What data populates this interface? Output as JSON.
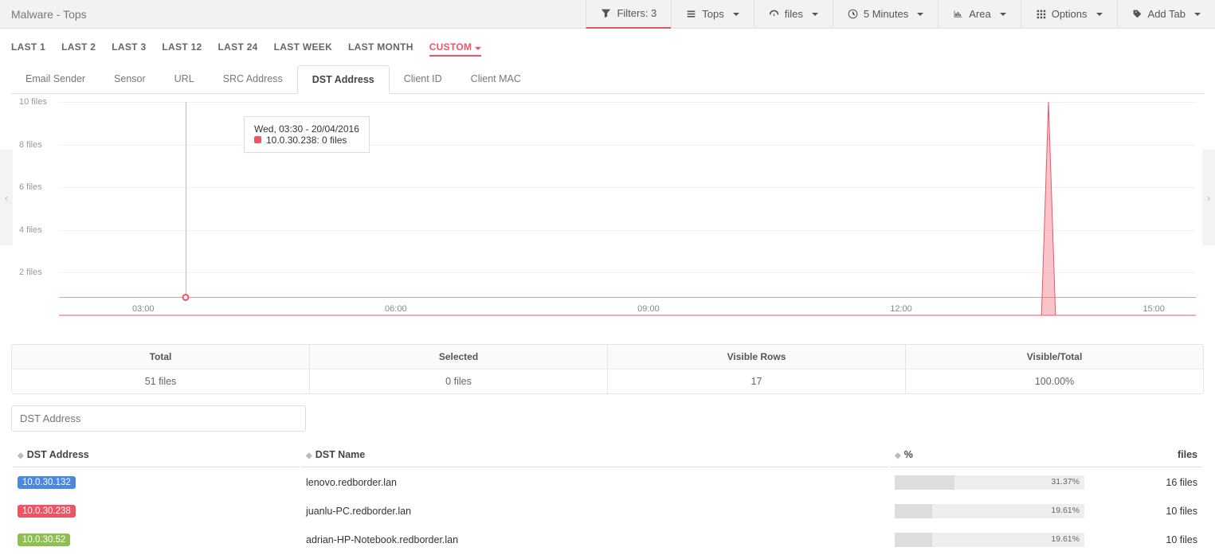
{
  "header": {
    "title": "Malware - Tops"
  },
  "toolbar": {
    "filters": "Filters: 3",
    "tops": "Tops",
    "files": "files",
    "interval": "5 Minutes",
    "area": "Area",
    "options": "Options",
    "addtab": "Add Tab"
  },
  "ranges": {
    "items": [
      "LAST 1",
      "LAST 2",
      "LAST 3",
      "LAST 12",
      "LAST 24",
      "LAST WEEK",
      "LAST MONTH",
      "CUSTOM"
    ],
    "active": "CUSTOM"
  },
  "tabs": {
    "items": [
      "Email Sender",
      "Sensor",
      "URL",
      "SRC Address",
      "DST Address",
      "Client ID",
      "Client MAC"
    ],
    "active": "DST Address"
  },
  "tooltip": {
    "timestamp": "Wed, 03:30 - 20/04/2016",
    "series_label": "10.0.30.238: 0 files"
  },
  "summary": {
    "total_label": "Total",
    "total_value": "51 files",
    "selected_label": "Selected",
    "selected_value": "0 files",
    "visible_label": "Visible Rows",
    "visible_value": "17",
    "ratio_label": "Visible/Total",
    "ratio_value": "100.00%"
  },
  "filter": {
    "placeholder": "DST Address"
  },
  "table": {
    "headers": {
      "addr": "DST Address",
      "name": "DST Name",
      "pct": "%",
      "files": "files"
    },
    "rows": [
      {
        "addr": "10.0.30.132",
        "color": "#4a89dc",
        "name": "lenovo.redborder.lan",
        "pct": "31.37%",
        "pct_num": 31.37,
        "files": "16 files"
      },
      {
        "addr": "10.0.30.238",
        "color": "#ed5565",
        "name": "juanlu-PC.redborder.lan",
        "pct": "19.61%",
        "pct_num": 19.61,
        "files": "10 files"
      },
      {
        "addr": "10.0.30.52",
        "color": "#8cc152",
        "name": "adrian-HP-Notebook.redborder.lan",
        "pct": "19.61%",
        "pct_num": 19.61,
        "files": "10 files"
      }
    ]
  },
  "chart_data": {
    "type": "area",
    "title": "",
    "xlabel": "",
    "ylabel": "files",
    "y_ticks": [
      2,
      4,
      6,
      8,
      10
    ],
    "y_tick_labels": [
      "2 files",
      "4 files",
      "6 files",
      "8 files",
      "10 files"
    ],
    "x_ticks": [
      "03:00",
      "06:00",
      "09:00",
      "12:00",
      "15:00"
    ],
    "xlim": [
      "02:00",
      "15:30"
    ],
    "ylim": [
      0,
      10
    ],
    "cursor_x": "03:30",
    "series": [
      {
        "name": "10.0.30.238",
        "color": "#ed5565",
        "points": [
          {
            "x": "02:00",
            "y": 0
          },
          {
            "x": "03:30",
            "y": 0
          },
          {
            "x": "06:00",
            "y": 0
          },
          {
            "x": "09:00",
            "y": 0
          },
          {
            "x": "12:00",
            "y": 0
          },
          {
            "x": "13:40",
            "y": 0
          },
          {
            "x": "13:45",
            "y": 10
          },
          {
            "x": "13:50",
            "y": 0
          },
          {
            "x": "15:30",
            "y": 0
          }
        ]
      }
    ]
  }
}
